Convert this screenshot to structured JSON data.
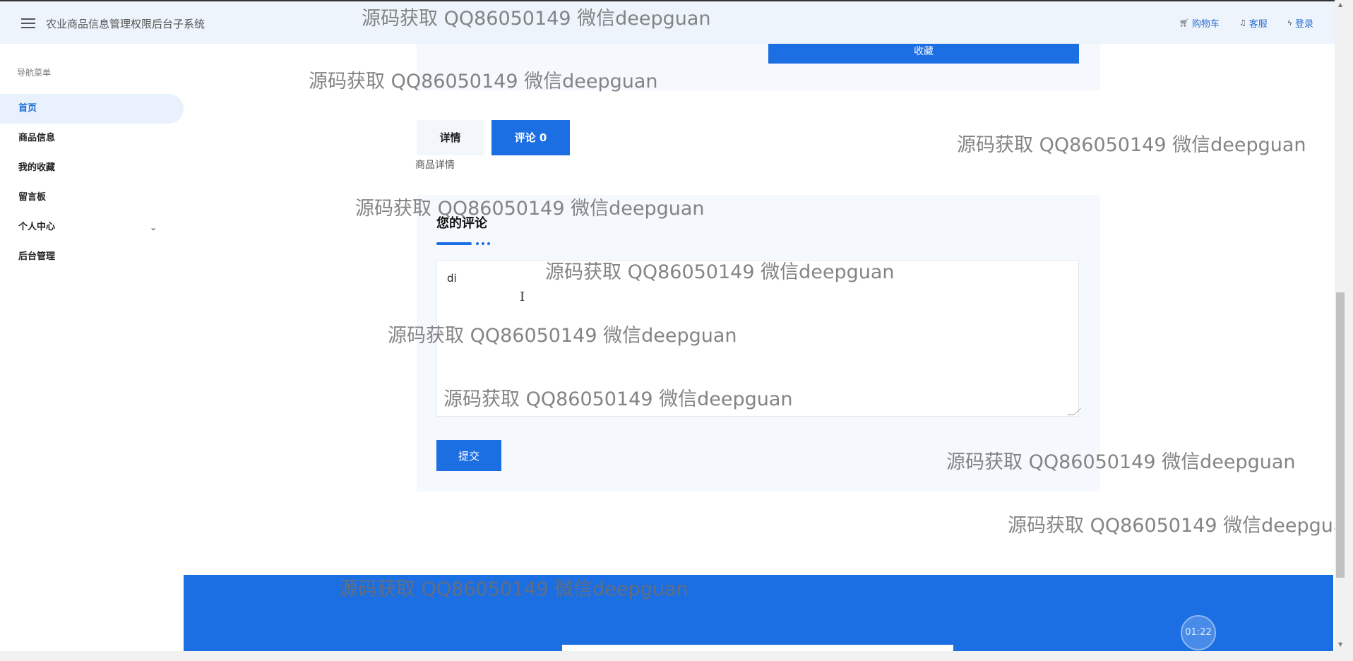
{
  "header": {
    "title": "农业商品信息管理权限后台子系统",
    "actions": [
      {
        "icon": "cart-icon",
        "label": "购物车"
      },
      {
        "icon": "bell-icon",
        "label": "客服"
      },
      {
        "icon": "bolt-icon",
        "label": "登录"
      }
    ]
  },
  "sidebar": {
    "title": "导航菜单",
    "items": [
      {
        "label": "首页",
        "active": true
      },
      {
        "label": "商品信息"
      },
      {
        "label": "我的收藏"
      },
      {
        "label": "留言板"
      },
      {
        "label": "个人中心",
        "has_children": true
      },
      {
        "label": "后台管理"
      }
    ]
  },
  "product": {
    "collect_button": "收藏"
  },
  "tabs": {
    "detail": "详情",
    "comment": "评论 0"
  },
  "detail_label": "商品详情",
  "comment_form": {
    "heading": "您的评论",
    "value": "di",
    "submit": "提交"
  },
  "timer": "01:22",
  "watermark": "源码获取 QQ86050149 微信deepguan",
  "colors": {
    "primary": "#1c6ee3",
    "header_bg": "#eef4fb",
    "card_bg": "#f5f9fe"
  }
}
